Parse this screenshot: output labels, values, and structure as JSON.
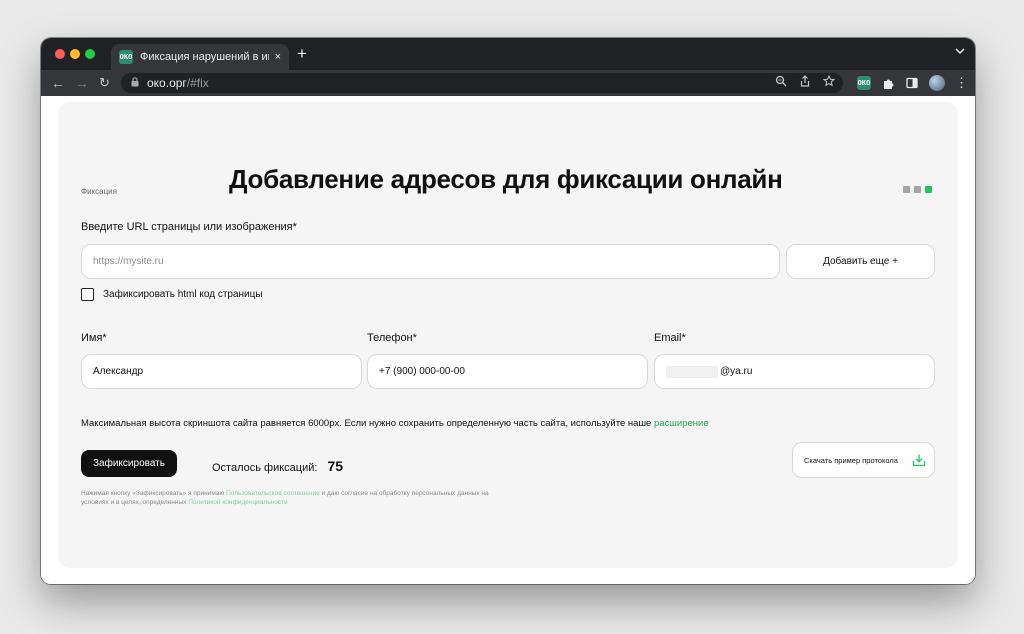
{
  "browser": {
    "tab_title": "Фиксация нарушений в интер",
    "tab_close": "×",
    "new_tab": "+",
    "favicon_text": "ОКО",
    "url_host": "око.орг",
    "url_path": "/#fix"
  },
  "page": {
    "breadcrumb": "Фиксация",
    "title": "Добавление адресов для фиксации онлайн",
    "steps": [
      {
        "state": "inactive"
      },
      {
        "state": "inactive"
      },
      {
        "state": "active"
      }
    ],
    "url_label": "Введите URL страницы или изображения*",
    "url_placeholder": "https://mysite.ru",
    "add_more_button": "Добавить еще +",
    "html_checkbox_label": "Зафиксировать html код страницы",
    "html_checkbox_checked": false,
    "name_label": "Имя*",
    "name_value": "Александр",
    "phone_label": "Телефон*",
    "phone_value": "+7 (900) 000-00-00",
    "email_label": "Email*",
    "email_value": "@ya.ru",
    "note_text": "Максимальная высота скриншота сайта равняется 6000px. Если нужно сохранить определенную часть сайта, используйте наше ",
    "note_link": "расширение",
    "submit_button": "Зафиксировать",
    "remaining_label": "Осталось фиксаций:",
    "remaining_count": "75",
    "download_button": "Скачать пример протокола",
    "legal_prefix": "Нажимая кнопку «Зафиксировать» я принимаю ",
    "legal_link_agreement": "Пользовательское соглашение",
    "legal_middle": " и даю согласие на обработку персональных данных на условиях и в целях, определенных ",
    "legal_link_privacy": "Политикой конфиденциальности"
  },
  "colors": {
    "accent_green": "#22c55e",
    "link_green": "#22a555",
    "button_dark": "#111111"
  }
}
